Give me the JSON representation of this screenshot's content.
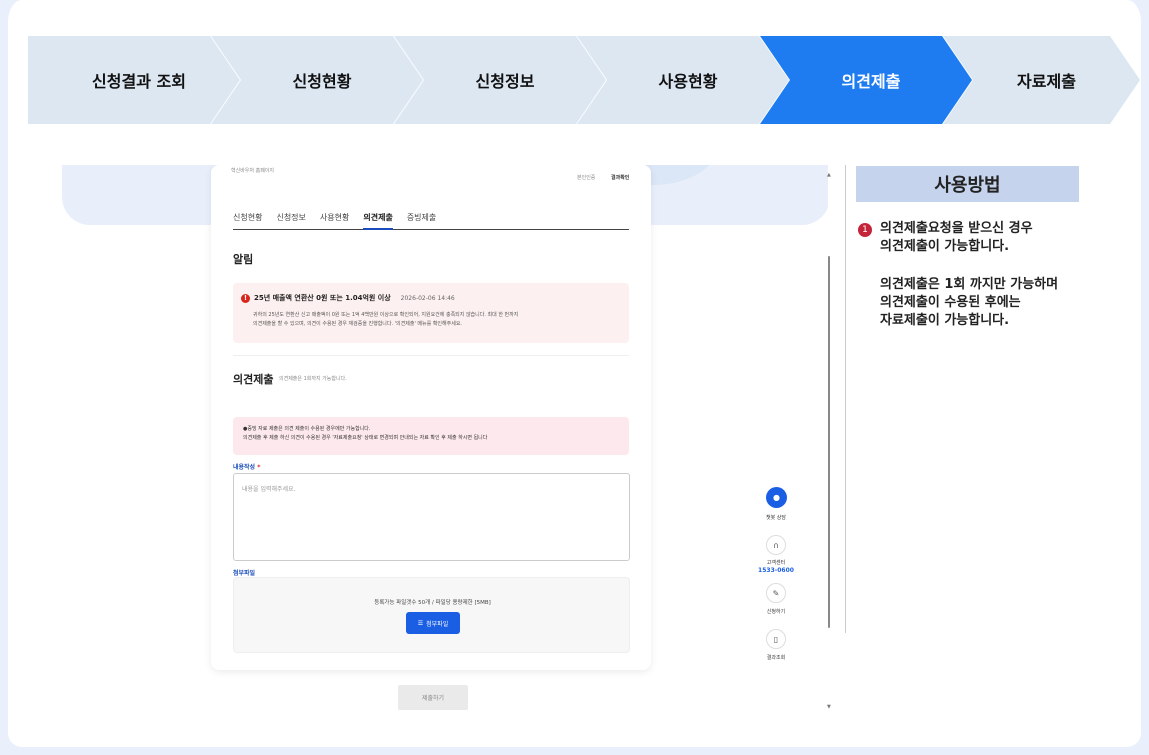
{
  "steps": [
    {
      "label": "신청결과 조회",
      "active": false
    },
    {
      "label": "신청현황",
      "active": false
    },
    {
      "label": "신청정보",
      "active": false
    },
    {
      "label": "사용현황",
      "active": false
    },
    {
      "label": "의견제출",
      "active": true
    },
    {
      "label": "자료제출",
      "active": false
    }
  ],
  "screen": {
    "top_left": "혁신바우처 홈페이지",
    "top_right_1": "본인인증",
    "top_right_2": "결과확인",
    "tabs": [
      "신청현황",
      "신청정보",
      "사용현황",
      "의견제출",
      "증빙제출"
    ],
    "active_tab": "의견제출",
    "notice_title": "알림",
    "notice": {
      "headline": "25년 매출액 연환산 0원 또는 1.04억원 이상",
      "date": "2026-02-06 14:46",
      "body_1": "귀하의 25년도 연환산 신고 매출액이 0원 또는 1억 4백만원 이상으로 확인되어, 지원요건에 충족되지 않습니다. 최대 한 번까지",
      "body_2": "의견제출을 할 수 있으며, 의견이 수용된 경우 재검증을 진행합니다. '의견제출' 메뉴를 확인해주세요."
    },
    "opinion_title": "의견제출",
    "opinion_sub": "의견제출은 1회까지 가능합니다.",
    "warn_1": "●증빙 자료 제출은 의견 제출이 수용된 경우에만 가능합니다.",
    "warn_2": "의견제출 후 제출 하신 의견이 수용된 경우 '자료제출요청' 상태로 변경되며 안내되는 자료 확인 후 제출 하시면 됩니다",
    "content_label": "내용작성",
    "content_required": "*",
    "content_placeholder": "내용을 입력해주세요.",
    "attach_label": "첨부파일",
    "attach_info": "등록가능 파일갯수 50개 / 파일당 용량제한 [5MB]",
    "attach_button": "첨부파일",
    "submit_button": "제출하기"
  },
  "floating": {
    "chat_label": "챗봇 상담",
    "center_label": "고객센터",
    "center_phone": "1533-0600",
    "apply_label": "신청하기",
    "result_label": "결과조회"
  },
  "guide": {
    "title": "사용방법",
    "num": "1",
    "line_1": "의견제출요청을 받으신 경우",
    "line_2": "의견제출이 가능합니다.",
    "line_3": "의견제출은 1회 까지만 가능하며",
    "line_4": "의견제출이 수용된 후에는",
    "line_5": "자료제출이 가능합니다."
  },
  "colors": {
    "active_step": "#1f7cf0",
    "step": "#dde7f2",
    "guide_title_bg": "#c6d3ec",
    "badge": "#c4243a"
  }
}
